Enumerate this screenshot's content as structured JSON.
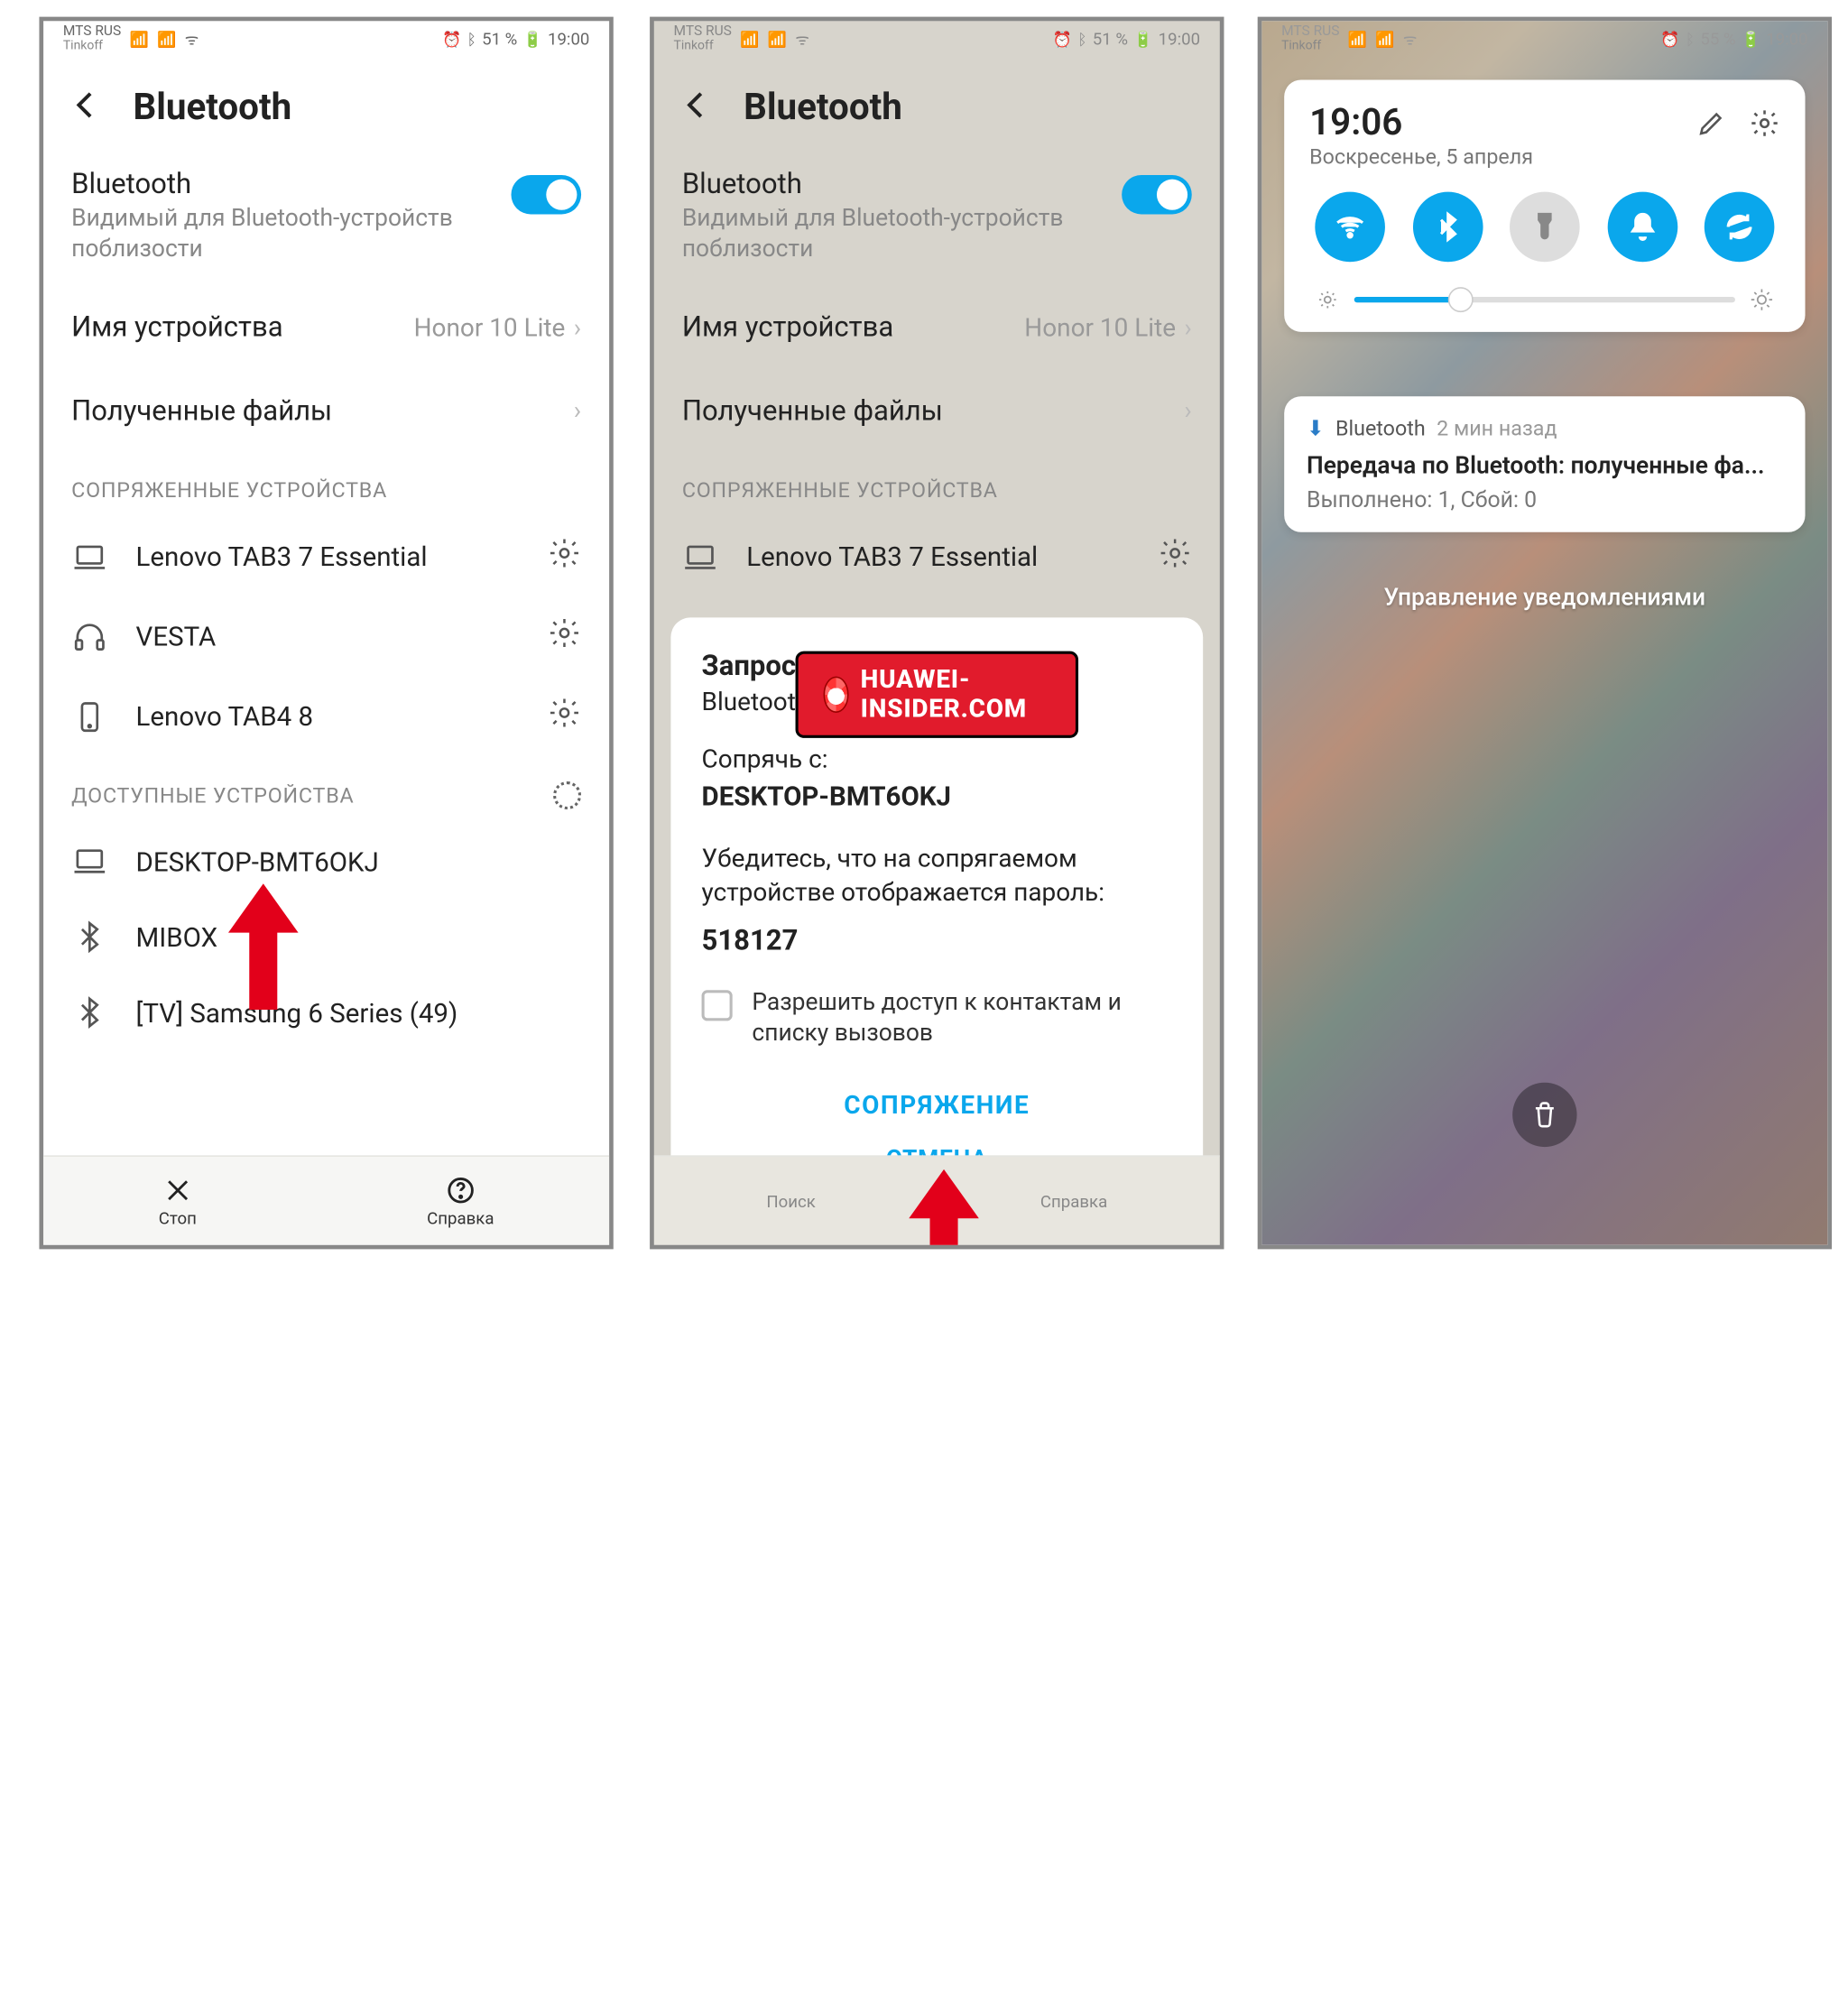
{
  "statusbar": {
    "carrier": "MTS RUS",
    "sub": "Tinkoff",
    "battery12": "51 %",
    "battery3": "55 %",
    "time12": "19:00",
    "time3": "19:00"
  },
  "bluetooth": {
    "title": "Bluetooth",
    "toggle_label": "Bluetooth",
    "toggle_sub": "Видимый для Bluetooth-устройств поблизости",
    "device_name_label": "Имя устройства",
    "device_name_value": "Honor 10 Lite",
    "received_files_label": "Полученные файлы",
    "section_paired": "СОПРЯЖЕННЫЕ УСТРОЙСТВА",
    "section_available": "ДОСТУПНЫЕ УСТРОЙСТВА",
    "paired": [
      {
        "name": "Lenovo TAB3 7 Essential",
        "icon": "laptop"
      },
      {
        "name": "VESTA",
        "icon": "headphones"
      },
      {
        "name": "Lenovo TAB4 8",
        "icon": "phone"
      }
    ],
    "available": [
      {
        "name": "DESKTOP-BMT6OKJ",
        "icon": "laptop"
      },
      {
        "name": "MIBOX",
        "icon": "bt"
      },
      {
        "name": "[TV] Samsung 6 Series (49)",
        "icon": "bt"
      }
    ]
  },
  "bottom": {
    "stop": "Стоп",
    "help": "Справка",
    "search": "Поиск"
  },
  "dialog": {
    "title_line1": "Запрос на сопряжение",
    "title_line2": "Bluetooth",
    "pair_label": "Сопрячь с:",
    "pair_device": "DESKTOP-BMT6OKJ",
    "pair_msg": "Убедитесь, что на сопрягаемом устройстве отображается пароль:",
    "pair_code": "518127",
    "allow_contacts": "Разрешить доступ к контактам и списку вызовов",
    "btn_pair": "СОПРЯЖЕНИЕ",
    "btn_cancel": "ОТМЕНА"
  },
  "watermark": "HUAWEI-INSIDER.COM",
  "qs": {
    "time": "19:06",
    "date": "Воскресенье, 5 апреля"
  },
  "notif": {
    "app": "Bluetooth",
    "age": "2 мин назад",
    "title": "Передача по Bluetooth: полученные фа...",
    "sub": "Выполнено: 1, Сбой: 0"
  },
  "manage": "Управление уведомлениями"
}
